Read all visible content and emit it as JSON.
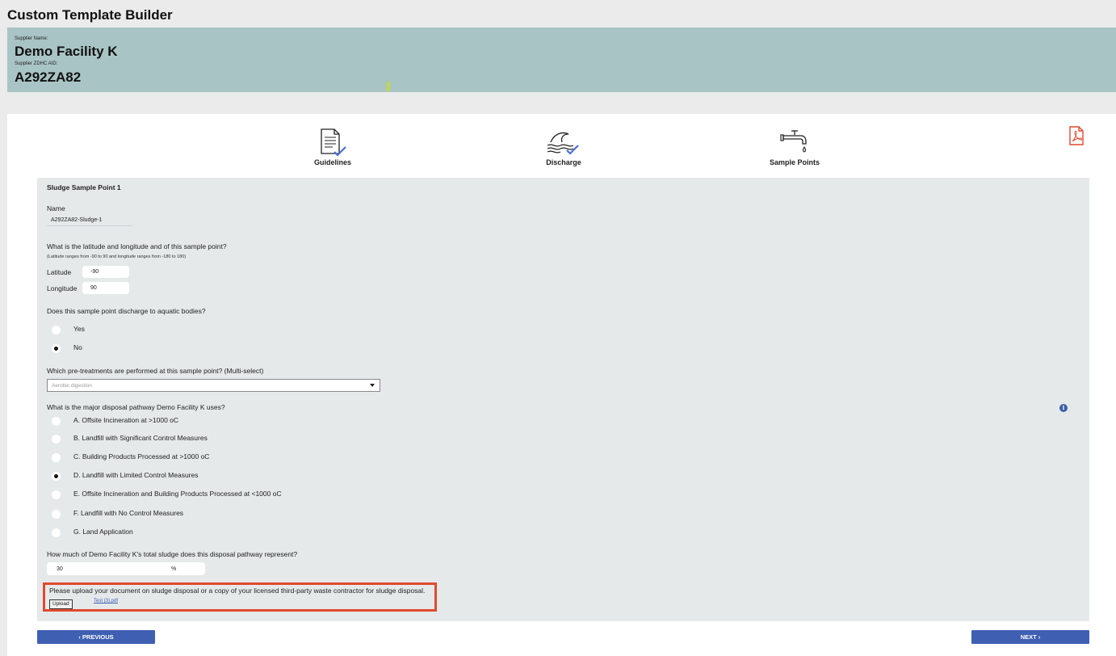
{
  "header": {
    "title": "Custom Template Builder"
  },
  "supplier": {
    "name_label": "Supplier Name:",
    "name": "Demo Facility K",
    "id_label": "Supplier ZDHC AID:",
    "id": "A292ZA82"
  },
  "steps": [
    {
      "label": "Guidelines",
      "icon": "document-check-icon"
    },
    {
      "label": "Discharge",
      "icon": "wave-check-icon"
    },
    {
      "label": "Sample Points",
      "icon": "faucet-icon"
    }
  ],
  "form": {
    "section_title": "Sludge Sample Point 1",
    "name_label": "Name",
    "name_value": "A292ZA82-Sludge-1",
    "latlong_question": "What is the latitude and longitude and of this sample point?",
    "latlong_hint": "(Latitude ranges from -90 to 90 and longitude ranges from -180 to 180)",
    "latitude_label": "Latitude",
    "latitude_value": "-90",
    "longitude_label": "Longitude",
    "longitude_value": "90",
    "aquatic_question": "Does this sample point discharge to aquatic bodies?",
    "aquatic_options": [
      {
        "label": "Yes",
        "checked": false
      },
      {
        "label": "No",
        "checked": true
      }
    ],
    "pretreat_question": "Which pre-treatments are performed at this sample point? (Multi-select)",
    "pretreat_placeholder": "Aerobic digestion",
    "disposal_question": "What is the major disposal pathway Demo Facility K uses?",
    "disposal_options": [
      {
        "label": "A. Offsite Incineration at >1000 oC",
        "checked": false
      },
      {
        "label": "B. Landfill with Significant Control Measures",
        "checked": false
      },
      {
        "label": "C. Building Products Processed at >1000 oC",
        "checked": false
      },
      {
        "label": "D. Landfill with Limited Control Measures",
        "checked": true
      },
      {
        "label": "E. Offsite Incineration and Building Products Processed at <1000 oC",
        "checked": false
      },
      {
        "label": "F. Landfill with No Control Measures",
        "checked": false
      },
      {
        "label": "G. Land Application",
        "checked": false
      }
    ],
    "percent_question": "How much of Demo Facility K's total sludge does this disposal pathway represent?",
    "percent_value": "30",
    "percent_unit": "%",
    "upload_text": "Please upload your document on sludge disposal or a copy of your licensed third-party waste contractor for sludge disposal.",
    "upload_button": "Upload",
    "uploaded_file": "Test (3).pdf"
  },
  "nav": {
    "previous": "‹ PREVIOUS",
    "next": "NEXT ›"
  },
  "colors": {
    "banner": "#a9c4c5",
    "accent": "#3f5fb3",
    "highlight": "#e04a2f",
    "check": "#4a6fd6"
  }
}
